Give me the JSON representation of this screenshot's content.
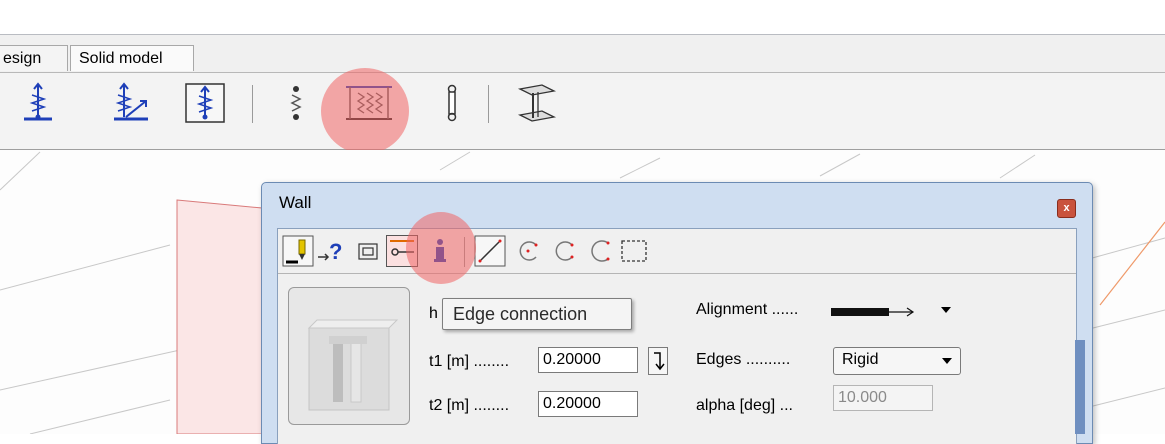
{
  "tabs": [
    {
      "label": "esign"
    },
    {
      "label": "Solid model"
    }
  ],
  "toolbar": {
    "buttons": [
      {
        "icon": "point-support-icon"
      },
      {
        "icon": "point-support-inclined-icon"
      },
      {
        "icon": "point-support-framed-icon"
      },
      {
        "icon": "line-support-icon"
      },
      {
        "icon": "wall-support-icon",
        "highlighted": true
      },
      {
        "icon": "rod-icon"
      },
      {
        "icon": "beam-section-icon"
      }
    ]
  },
  "dialog": {
    "title": "Wall",
    "close_label": "x",
    "toolbar": [
      {
        "icon": "pick-element-icon"
      },
      {
        "icon": "help-arrow-icon"
      },
      {
        "icon": "rectangle-icon"
      },
      {
        "icon": "edge-connection-icon",
        "highlighted": true
      },
      {
        "icon": "info-icon"
      },
      {
        "icon": "line-draw-icon"
      },
      {
        "icon": "arc-cw-icon"
      },
      {
        "icon": "arc-ccw-icon"
      },
      {
        "icon": "arc-icon"
      },
      {
        "icon": "selection-rect-icon"
      }
    ],
    "tooltip": "Edge connection",
    "fields": {
      "h_label": "h [",
      "t1_label": "t1 [m] ........",
      "t1_value": "0.20000",
      "t2_label": "t2 [m] ........",
      "t2_value": "0.20000",
      "alignment_label": "Alignment ......",
      "edges_label": "Edges ..........",
      "edges_value": "Rigid",
      "alpha_label": "alpha [deg] ...",
      "alpha_value": "10.000"
    }
  },
  "colors": {
    "highlight": "#f06464",
    "dialog_frame": "#cfdef1",
    "icon_blue": "#1e3fb8"
  }
}
